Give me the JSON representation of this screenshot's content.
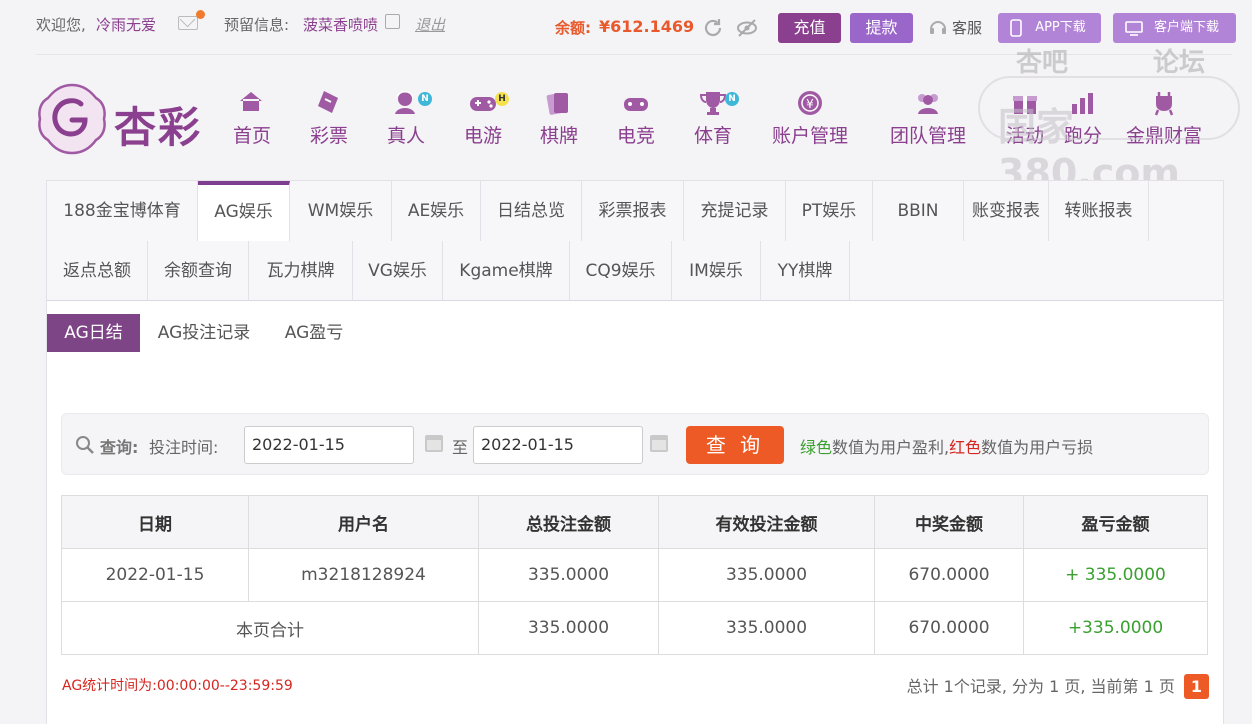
{
  "topbar": {
    "welcome": "欢迎您,",
    "username": "冷雨无爱",
    "reserved_label": "预留信息:",
    "reserved_value": "菠菜香喷喷",
    "logout": "退出",
    "balance_label": "余额:",
    "balance_value": "¥612.1469",
    "recharge": "充值",
    "withdraw": "提款",
    "service": "客服",
    "app_download": "APP下载",
    "client_download": "客户端下载"
  },
  "brand": {
    "logo_text": "杏彩"
  },
  "nav": [
    {
      "label": "首页",
      "icon": "home-icon"
    },
    {
      "label": "彩票",
      "icon": "ticket-icon"
    },
    {
      "label": "真人",
      "icon": "dealer-icon",
      "badge": "N"
    },
    {
      "label": "电游",
      "icon": "gamepad-icon",
      "badge": "H"
    },
    {
      "label": "棋牌",
      "icon": "cards-icon"
    },
    {
      "label": "电竞",
      "icon": "esports-icon"
    },
    {
      "label": "体育",
      "icon": "trophy-icon",
      "badge": "N"
    },
    {
      "label": "账户管理",
      "icon": "coin-icon"
    },
    {
      "label": "团队管理",
      "icon": "team-icon"
    },
    {
      "label": "活动",
      "icon": "gift-icon"
    },
    {
      "label": "跑分",
      "icon": "chart-icon"
    },
    {
      "label": "金鼎财富",
      "icon": "tripod-icon"
    }
  ],
  "watermark": {
    "line1": "杏吧",
    "line2": "论坛",
    "line3": "国家380.com"
  },
  "tabs": [
    "188金宝博体育",
    "AG娱乐",
    "WM娱乐",
    "AE娱乐",
    "日结总览",
    "彩票报表",
    "充提记录",
    "PT娱乐",
    "BBIN",
    "账变报表",
    "转账报表",
    "返点总额",
    "余额查询",
    "瓦力棋牌",
    "VG娱乐",
    "Kgame棋牌",
    "CQ9娱乐",
    "IM娱乐",
    "YY棋牌"
  ],
  "active_tab": "AG娱乐",
  "subtabs": [
    "AG日结",
    "AG投注记录",
    "AG盈亏"
  ],
  "query": {
    "label": "查询:",
    "time_label": "投注时间:",
    "start_date": "2022-01-15",
    "to": "至",
    "end_date": "2022-01-15",
    "button": "查 询",
    "note_green": "绿色",
    "note_mid": "数值为用户盈利,",
    "note_red": "红色",
    "note_end": "数值为用户亏损"
  },
  "table": {
    "headers": [
      "日期",
      "用户名",
      "总投注金额",
      "有效投注金额",
      "中奖金额",
      "盈亏金额"
    ],
    "rows": [
      [
        "2022-01-15",
        "m3218128924",
        "335.0000",
        "335.0000",
        "670.0000",
        "+ 335.0000"
      ]
    ],
    "total_label": "本页合计",
    "total": [
      "335.0000",
      "335.0000",
      "670.0000",
      "+335.0000"
    ]
  },
  "footer": {
    "stat_time": "AG统计时间为:00:00:00--23:59:59",
    "pagination": "总计 1个记录, 分为 1 页, 当前第 1 页",
    "current_page": "1"
  },
  "colors": {
    "brand": "#8a3f8f",
    "accent": "#ee5a26",
    "profit": "#3aa030",
    "loss": "#d5261f"
  }
}
